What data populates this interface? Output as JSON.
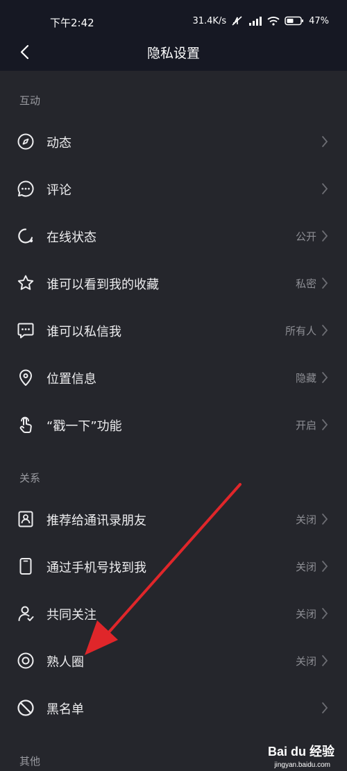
{
  "status_bar": {
    "time": "下午2:42",
    "network_speed": "31.4K/s",
    "battery": "47%"
  },
  "nav": {
    "title": "隐私设置"
  },
  "sections": {
    "interaction": {
      "header": "互动",
      "items": [
        {
          "label": "动态",
          "value": "",
          "icon": "compass-icon"
        },
        {
          "label": "评论",
          "value": "",
          "icon": "comment-icon"
        },
        {
          "label": "在线状态",
          "value": "公开",
          "icon": "online-status-icon"
        },
        {
          "label": "谁可以看到我的收藏",
          "value": "私密",
          "icon": "star-icon"
        },
        {
          "label": "谁可以私信我",
          "value": "所有人",
          "icon": "message-icon"
        },
        {
          "label": "位置信息",
          "value": "隐藏",
          "icon": "location-icon"
        },
        {
          "label": "“戳一下”功能",
          "value": "开启",
          "icon": "poke-icon"
        }
      ]
    },
    "relations": {
      "header": "关系",
      "items": [
        {
          "label": "推荐给通讯录朋友",
          "value": "关闭",
          "icon": "contact-card-icon"
        },
        {
          "label": "通过手机号找到我",
          "value": "关闭",
          "icon": "phone-icon"
        },
        {
          "label": "共同关注",
          "value": "关闭",
          "icon": "user-icon"
        },
        {
          "label": "熟人圈",
          "value": "关闭",
          "icon": "circle-icon"
        },
        {
          "label": "黑名单",
          "value": "",
          "icon": "block-icon"
        }
      ]
    },
    "other": {
      "header": "其他"
    }
  },
  "watermark": {
    "logo": "Bai du 经验",
    "url": "jingyan.baidu.com"
  },
  "colors": {
    "background": "#25262c",
    "header_bg": "#161823",
    "annotation_arrow": "#e0262a"
  }
}
